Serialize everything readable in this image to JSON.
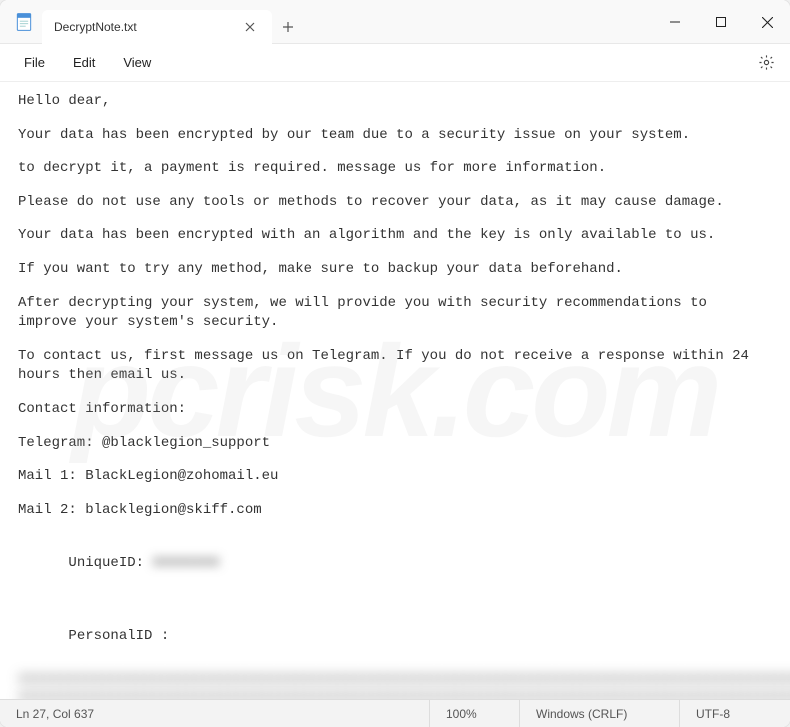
{
  "titlebar": {
    "tab_title": "DecryptNote.txt"
  },
  "menubar": {
    "file": "File",
    "edit": "Edit",
    "view": "View"
  },
  "content": {
    "p1": "Hello dear,",
    "p2": "Your data has been encrypted by our team due to a security issue on your system.",
    "p3": "to decrypt it, a payment is required. message us for more information.",
    "p4": "Please do not use any tools or methods to recover your data, as it may cause damage.",
    "p5": "Your data has been encrypted with an algorithm and the key is only available to us.",
    "p6": "If you want to try any method, make sure to backup your data beforehand.",
    "p7": "After decrypting your system, we will provide you with security recommendations to improve your system's security.",
    "p8": "To contact us, first message us on Telegram. If you do not receive a response within 24 hours then email us.",
    "p9": "Contact information:",
    "p10": "Telegram: @blacklegion_support",
    "p11": "Mail 1: BlackLegion@zohomail.eu",
    "p12": "Mail 2: blacklegion@skiff.com",
    "p13_label": "UniqueID: ",
    "p13_value": "XXXXXXXX",
    "p14_label": "PersonalID :",
    "p14_value1": "xxxxxxxxxxxxxxxxxxxxxxxxxxxxxxxxxxxxxxxxxxxxxxxxxxxxxxxxxxxxxxxxxxxxxxxxxxxxxxxxxxxxxxxxxxxxxxxxxxxxxxxxxx",
    "p14_value2": "xxxxxxxxxxxxxxxxxxxxxxxxxxxxxxxxxxxxxxxxxxxxxxxxxxxxxxxxxxxxxxxxxxxxxxxxxxxxxxxxxxxxxxxxxxxxxxxxxxxxxxxxxx"
  },
  "statusbar": {
    "position": "Ln 27, Col 637",
    "zoom": "100%",
    "lineending": "Windows (CRLF)",
    "encoding": "UTF-8"
  },
  "watermark": "pcrisk.com"
}
